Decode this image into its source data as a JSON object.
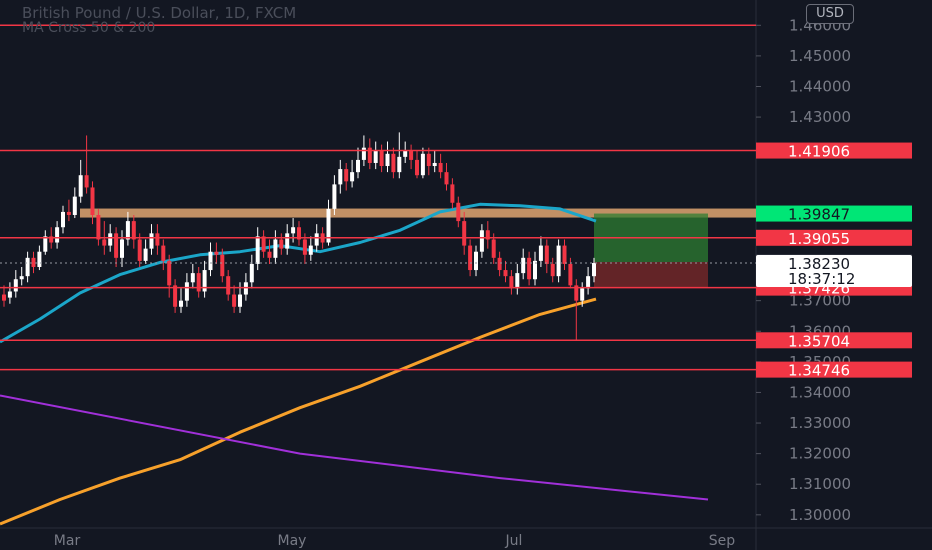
{
  "chart_data": {
    "type": "candlestick",
    "title": "British Pound / U.S. Dollar, 1D, FXCM",
    "subtitle": "MA Cross 50 & 200",
    "currency": "USD",
    "y_ticks": [
      "1.46000",
      "1.45000",
      "1.44000",
      "1.43000",
      "1.37000",
      "1.36000",
      "1.35000",
      "1.34000",
      "1.33000",
      "1.32000",
      "1.31000",
      "1.30000"
    ],
    "ylim": [
      1.297,
      1.465
    ],
    "x_ticks": [
      "Mar",
      "May",
      "Jul",
      "Sep"
    ],
    "horizontal_levels": [
      {
        "value": 1.46,
        "label": "1.46000",
        "color": "#f23645",
        "label_visible": false
      },
      {
        "value": 1.41906,
        "label": "1.41906",
        "color": "#f23645"
      },
      {
        "value": 1.39055,
        "label": "1.39055",
        "color": "#f23645"
      },
      {
        "value": 1.37426,
        "label": "1.37426",
        "color": "#f23645"
      },
      {
        "value": 1.35704,
        "label": "1.35704",
        "color": "#f23645"
      },
      {
        "value": 1.34746,
        "label": "1.34746",
        "color": "#f23645"
      }
    ],
    "resistance_zone": {
      "value": 1.39847,
      "label": "1.39847",
      "color": "#e0a671"
    },
    "price_labels": {
      "high_line": "1.38262",
      "current": "1.38230",
      "countdown": "18:37:12"
    },
    "position_box": {
      "entry": 1.38262,
      "target": 1.39847,
      "stop": 1.37426,
      "profit_color": "#2e7d32",
      "loss_color": "#7f2a2a"
    },
    "series": [
      {
        "name": "MA 50",
        "color": "#1ba6c9",
        "points": [
          [
            0,
            1.3565
          ],
          [
            40,
            1.364
          ],
          [
            80,
            1.3725
          ],
          [
            120,
            1.3785
          ],
          [
            160,
            1.3825
          ],
          [
            200,
            1.385
          ],
          [
            240,
            1.386
          ],
          [
            280,
            1.388
          ],
          [
            320,
            1.386
          ],
          [
            360,
            1.389
          ],
          [
            400,
            1.393
          ],
          [
            440,
            1.399
          ],
          [
            480,
            1.4015
          ],
          [
            520,
            1.401
          ],
          [
            560,
            1.4
          ],
          [
            596,
            1.396
          ]
        ]
      },
      {
        "name": "MA 200",
        "color": "#f7a12b",
        "points": [
          [
            0,
            1.297
          ],
          [
            60,
            1.305
          ],
          [
            120,
            1.312
          ],
          [
            180,
            1.318
          ],
          [
            240,
            1.327
          ],
          [
            300,
            1.335
          ],
          [
            360,
            1.342
          ],
          [
            420,
            1.35
          ],
          [
            480,
            1.358
          ],
          [
            540,
            1.3655
          ],
          [
            596,
            1.3705
          ]
        ]
      },
      {
        "name": "",
        "color": "#a130d9",
        "points": [
          [
            0,
            1.339
          ],
          [
            300,
            1.32
          ],
          [
            500,
            1.312
          ],
          [
            708,
            1.305
          ]
        ]
      }
    ],
    "candles": [
      [
        1.372,
        1.37,
        1.375,
        1.368
      ],
      [
        1.371,
        1.373,
        1.376,
        1.369
      ],
      [
        1.373,
        1.377,
        1.38,
        1.371
      ],
      [
        1.377,
        1.378,
        1.381,
        1.375
      ],
      [
        1.378,
        1.384,
        1.386,
        1.376
      ],
      [
        1.384,
        1.381,
        1.386,
        1.379
      ],
      [
        1.381,
        1.386,
        1.388,
        1.38
      ],
      [
        1.386,
        1.391,
        1.393,
        1.385
      ],
      [
        1.391,
        1.389,
        1.394,
        1.387
      ],
      [
        1.389,
        1.394,
        1.396,
        1.387
      ],
      [
        1.394,
        1.399,
        1.401,
        1.392
      ],
      [
        1.399,
        1.398,
        1.403,
        1.396
      ],
      [
        1.398,
        1.404,
        1.407,
        1.397
      ],
      [
        1.404,
        1.411,
        1.416,
        1.402
      ],
      [
        1.411,
        1.407,
        1.424,
        1.405
      ],
      [
        1.407,
        1.398,
        1.409,
        1.395
      ],
      [
        1.398,
        1.39,
        1.4,
        1.388
      ],
      [
        1.39,
        1.388,
        1.396,
        1.385
      ],
      [
        1.388,
        1.392,
        1.395,
        1.386
      ],
      [
        1.392,
        1.384,
        1.394,
        1.381
      ],
      [
        1.384,
        1.39,
        1.393,
        1.381
      ],
      [
        1.39,
        1.396,
        1.399,
        1.388
      ],
      [
        1.396,
        1.39,
        1.398,
        1.387
      ],
      [
        1.39,
        1.383,
        1.392,
        1.381
      ],
      [
        1.383,
        1.387,
        1.39,
        1.382
      ],
      [
        1.387,
        1.392,
        1.395,
        1.385
      ],
      [
        1.392,
        1.388,
        1.395,
        1.385
      ],
      [
        1.388,
        1.383,
        1.39,
        1.38
      ],
      [
        1.383,
        1.375,
        1.385,
        1.371
      ],
      [
        1.375,
        1.368,
        1.377,
        1.366
      ],
      [
        1.368,
        1.37,
        1.374,
        1.366
      ],
      [
        1.37,
        1.376,
        1.379,
        1.368
      ],
      [
        1.376,
        1.379,
        1.382,
        1.374
      ],
      [
        1.379,
        1.373,
        1.381,
        1.371
      ],
      [
        1.373,
        1.38,
        1.383,
        1.371
      ],
      [
        1.38,
        1.386,
        1.389,
        1.378
      ],
      [
        1.386,
        1.385,
        1.389,
        1.382
      ],
      [
        1.385,
        1.378,
        1.387,
        1.376
      ],
      [
        1.378,
        1.372,
        1.38,
        1.37
      ],
      [
        1.372,
        1.368,
        1.375,
        1.366
      ],
      [
        1.368,
        1.372,
        1.376,
        1.366
      ],
      [
        1.372,
        1.376,
        1.379,
        1.37
      ],
      [
        1.376,
        1.382,
        1.385,
        1.374
      ],
      [
        1.382,
        1.391,
        1.394,
        1.38
      ],
      [
        1.391,
        1.386,
        1.393,
        1.384
      ],
      [
        1.386,
        1.384,
        1.39,
        1.382
      ],
      [
        1.384,
        1.39,
        1.393,
        1.382
      ],
      [
        1.39,
        1.387,
        1.392,
        1.385
      ],
      [
        1.387,
        1.392,
        1.395,
        1.385
      ],
      [
        1.392,
        1.394,
        1.397,
        1.389
      ],
      [
        1.394,
        1.39,
        1.396,
        1.388
      ],
      [
        1.39,
        1.385,
        1.392,
        1.382
      ],
      [
        1.385,
        1.388,
        1.391,
        1.383
      ],
      [
        1.388,
        1.392,
        1.395,
        1.386
      ],
      [
        1.392,
        1.389,
        1.394,
        1.387
      ],
      [
        1.389,
        1.4,
        1.403,
        1.388
      ],
      [
        1.4,
        1.408,
        1.411,
        1.398
      ],
      [
        1.408,
        1.413,
        1.416,
        1.405
      ],
      [
        1.413,
        1.409,
        1.415,
        1.406
      ],
      [
        1.409,
        1.412,
        1.416,
        1.407
      ],
      [
        1.412,
        1.416,
        1.42,
        1.41
      ],
      [
        1.416,
        1.42,
        1.424,
        1.414
      ],
      [
        1.42,
        1.415,
        1.423,
        1.413
      ],
      [
        1.415,
        1.419,
        1.422,
        1.413
      ],
      [
        1.419,
        1.414,
        1.421,
        1.412
      ],
      [
        1.414,
        1.418,
        1.422,
        1.412
      ],
      [
        1.418,
        1.412,
        1.42,
        1.41
      ],
      [
        1.412,
        1.417,
        1.425,
        1.41
      ],
      [
        1.417,
        1.419,
        1.422,
        1.415
      ],
      [
        1.419,
        1.416,
        1.421,
        1.413
      ],
      [
        1.416,
        1.411,
        1.419,
        1.41
      ],
      [
        1.411,
        1.418,
        1.42,
        1.41
      ],
      [
        1.418,
        1.414,
        1.42,
        1.411
      ],
      [
        1.414,
        1.415,
        1.419,
        1.412
      ],
      [
        1.415,
        1.412,
        1.418,
        1.41
      ],
      [
        1.412,
        1.408,
        1.415,
        1.406
      ],
      [
        1.408,
        1.402,
        1.41,
        1.4
      ],
      [
        1.402,
        1.396,
        1.404,
        1.394
      ],
      [
        1.396,
        1.388,
        1.399,
        1.385
      ],
      [
        1.388,
        1.38,
        1.39,
        1.378
      ],
      [
        1.38,
        1.386,
        1.388,
        1.378
      ],
      [
        1.386,
        1.393,
        1.395,
        1.384
      ],
      [
        1.393,
        1.39,
        1.396,
        1.387
      ],
      [
        1.39,
        1.384,
        1.392,
        1.382
      ],
      [
        1.384,
        1.38,
        1.386,
        1.378
      ],
      [
        1.38,
        1.378,
        1.383,
        1.376
      ],
      [
        1.378,
        1.374,
        1.38,
        1.372
      ],
      [
        1.374,
        1.379,
        1.382,
        1.372
      ],
      [
        1.379,
        1.384,
        1.387,
        1.377
      ],
      [
        1.384,
        1.377,
        1.386,
        1.375
      ],
      [
        1.377,
        1.383,
        1.386,
        1.375
      ],
      [
        1.383,
        1.388,
        1.391,
        1.381
      ],
      [
        1.388,
        1.382,
        1.39,
        1.379
      ],
      [
        1.382,
        1.378,
        1.384,
        1.376
      ],
      [
        1.378,
        1.388,
        1.39,
        1.376
      ],
      [
        1.388,
        1.382,
        1.39,
        1.38
      ],
      [
        1.382,
        1.375,
        1.384,
        1.374
      ],
      [
        1.375,
        1.37,
        1.377,
        1.357
      ],
      [
        1.37,
        1.374,
        1.376,
        1.368
      ],
      [
        1.374,
        1.378,
        1.381,
        1.372
      ],
      [
        1.378,
        1.3823,
        1.384,
        1.376
      ]
    ]
  }
}
